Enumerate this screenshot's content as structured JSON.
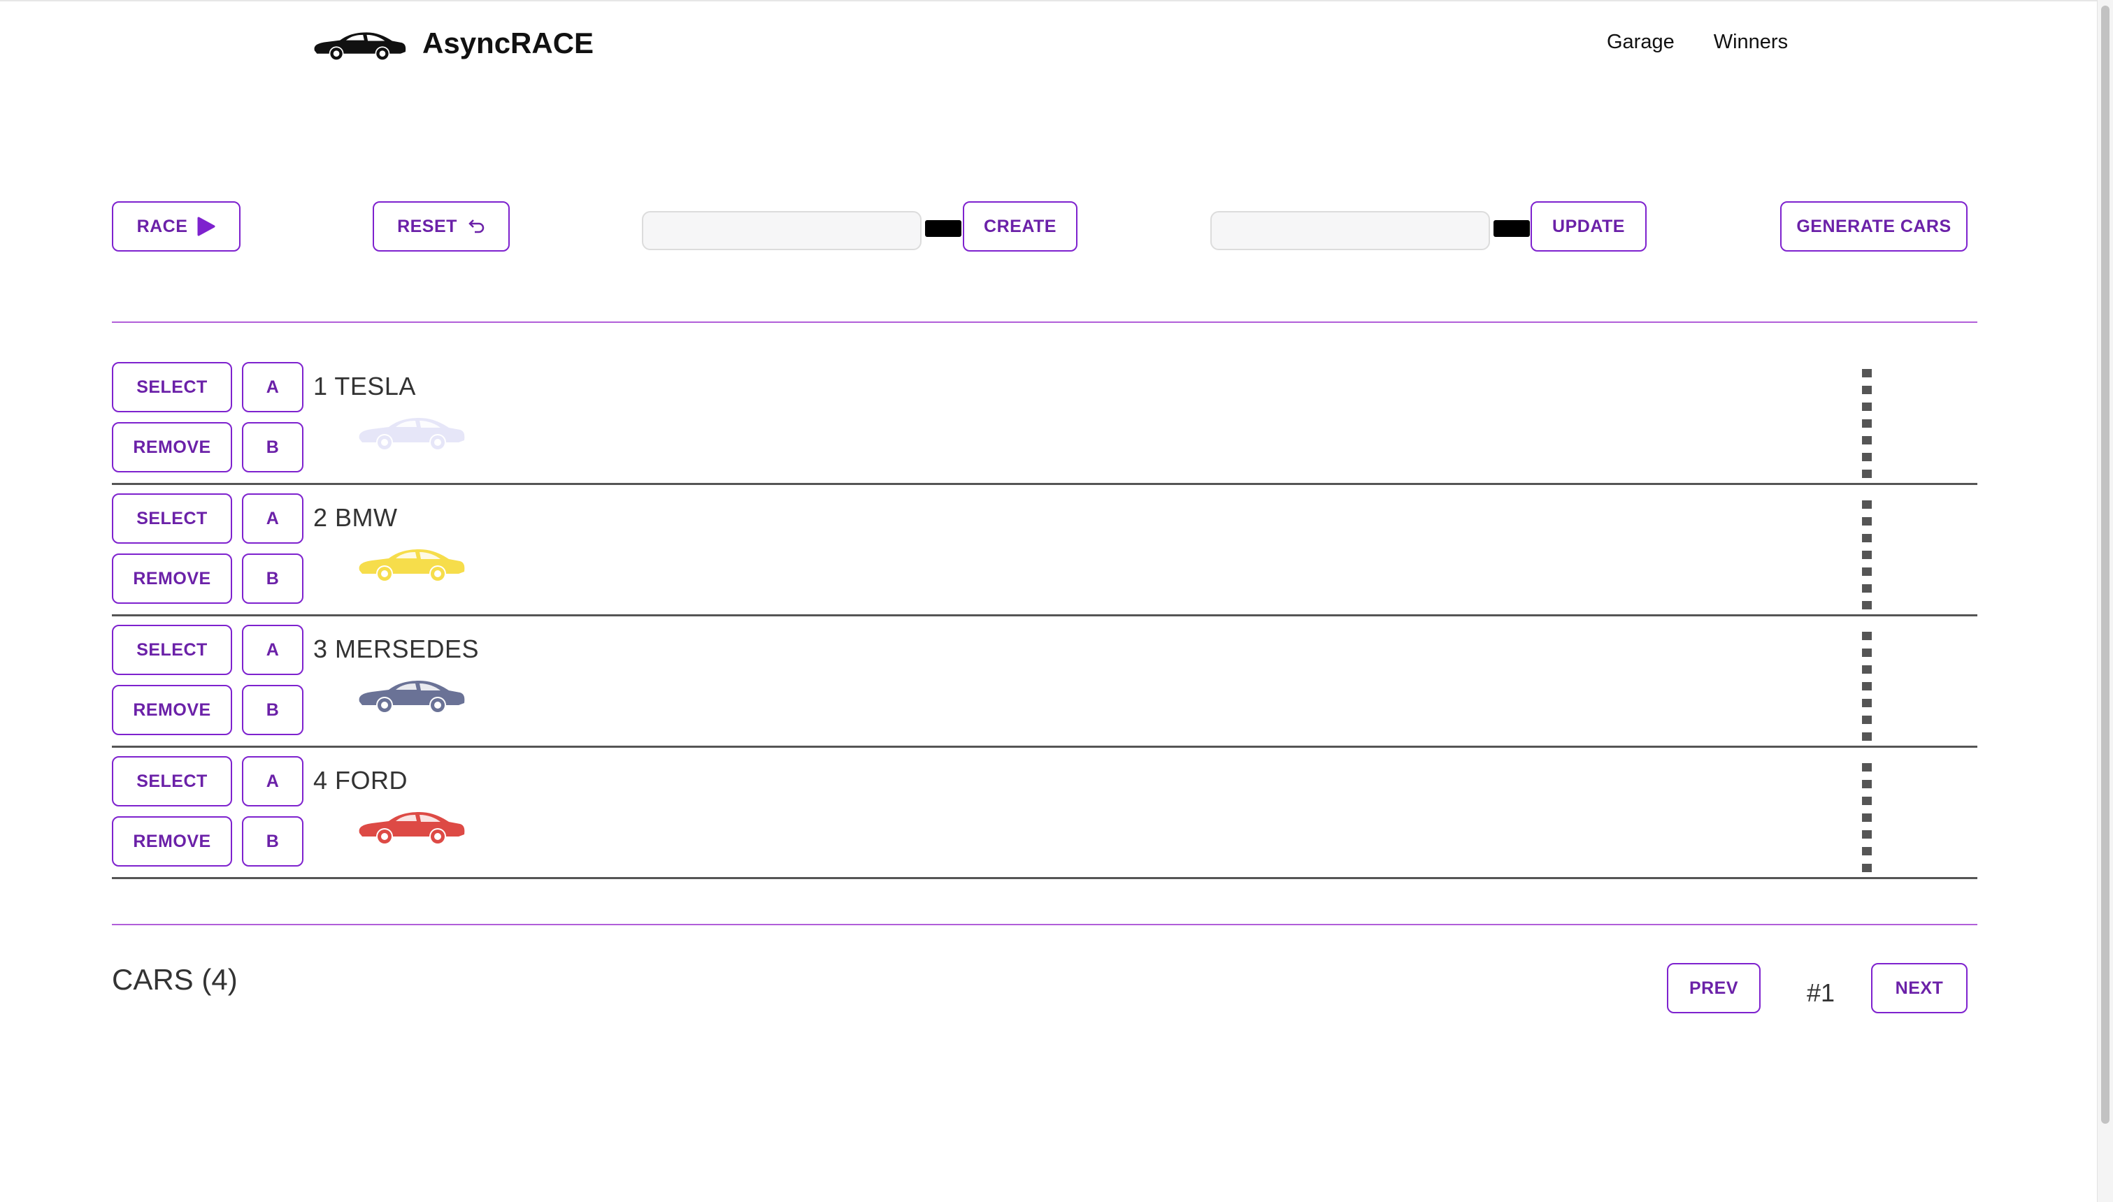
{
  "app": {
    "title": "AsyncRACE"
  },
  "nav": {
    "garage": "Garage",
    "winners": "Winners"
  },
  "controls": {
    "race_label": "RACE",
    "reset_label": "RESET",
    "create_label": "CREATE",
    "update_label": "UPDATE",
    "generate_label": "GENERATE CARS",
    "create_input": {
      "value": "",
      "placeholder": ""
    },
    "update_input": {
      "value": "",
      "placeholder": ""
    },
    "create_color": "#000000",
    "update_color": "#000000"
  },
  "track_buttons": {
    "select": "SELECT",
    "remove": "REMOVE",
    "start": "A",
    "stop": "B"
  },
  "cars": [
    {
      "label": "1 TESLA",
      "color": "#e6e6f8"
    },
    {
      "label": "2 BMW",
      "color": "#f6dd4b"
    },
    {
      "label": "3 MERSEDES",
      "color": "#6a7296"
    },
    {
      "label": "4 FORD",
      "color": "#dd4a45"
    }
  ],
  "footer": {
    "count": "CARS (4)",
    "prev": "PREV",
    "page": "#1",
    "next": "NEXT"
  },
  "icons": {
    "logo": "car-icon",
    "race": "play-icon",
    "reset": "undo-icon",
    "car": "car-icon"
  }
}
